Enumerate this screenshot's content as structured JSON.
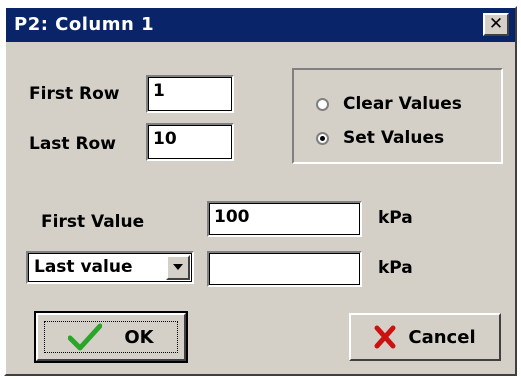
{
  "window": {
    "title": "P2:  Column 1",
    "close_glyph": "✕"
  },
  "rows": {
    "first_row_label": "First Row",
    "first_row_value": "1",
    "last_row_label": "Last Row",
    "last_row_value": "10"
  },
  "mode": {
    "options": [
      {
        "label": "Clear Values",
        "selected": false
      },
      {
        "label": "Set Values",
        "selected": true
      }
    ]
  },
  "values": {
    "first_value_label": "First Value",
    "first_value": "100",
    "first_unit": "kPa",
    "last_selector": "Last value",
    "last_value": "",
    "last_unit": "kPa"
  },
  "buttons": {
    "ok_label": "OK",
    "cancel_label": "Cancel"
  },
  "icons": {
    "ok": "check-icon",
    "cancel": "x-mark-icon",
    "combo": "chevron-down-icon"
  },
  "colors": {
    "title_bar": "#0a246a",
    "face": "#d4d0c8",
    "check": "#2aa52a",
    "cancel_x": "#cc1111"
  }
}
